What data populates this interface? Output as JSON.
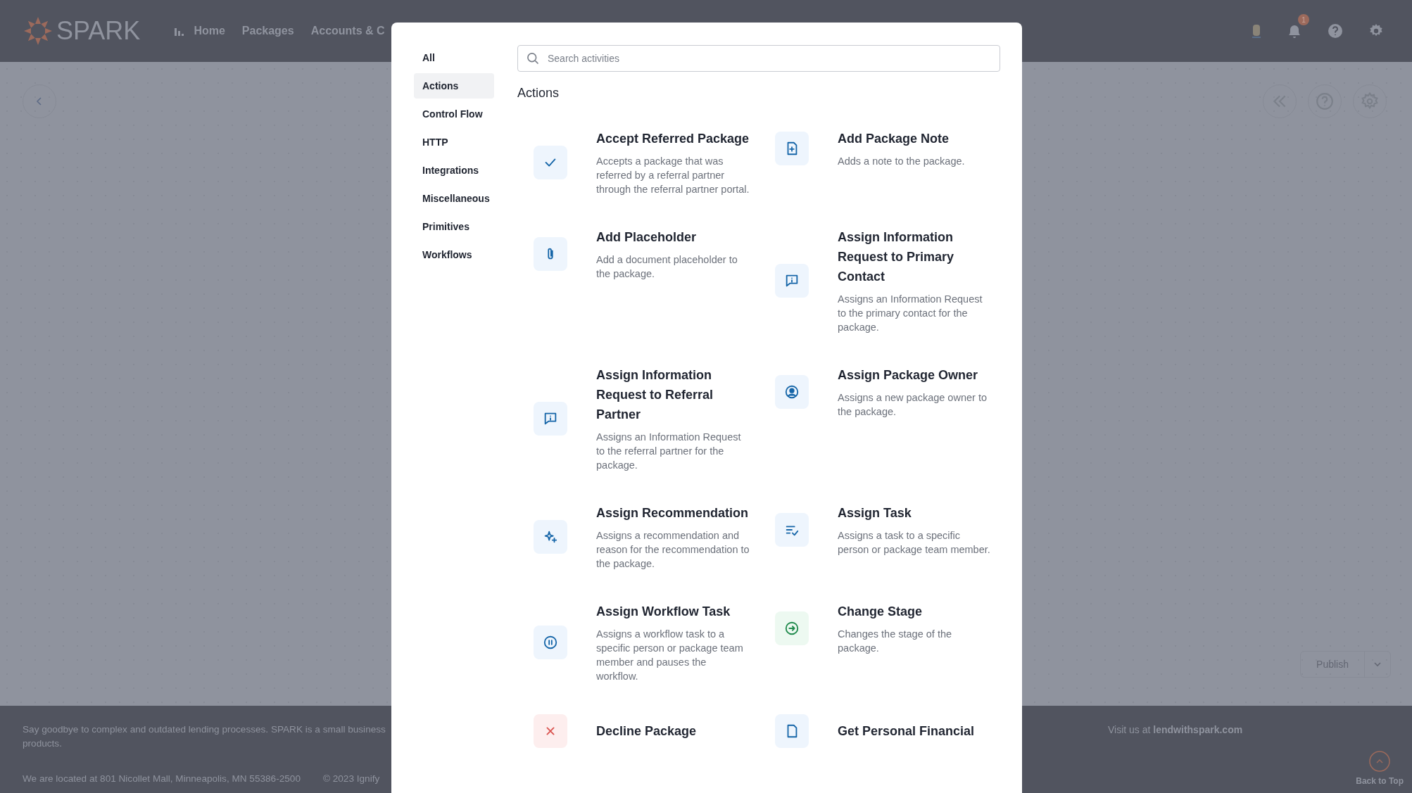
{
  "header": {
    "logo": "SPARK",
    "nav": [
      "Home",
      "Packages",
      "Accounts & C"
    ],
    "notification_count": "1"
  },
  "canvas": {
    "publish_button": "Publish"
  },
  "footer": {
    "tagline": "Say goodbye to complex and outdated lending processes. SPARK is a small business",
    "tagline_continued": "products.",
    "address": "We are located at 801 Nicollet Mall, Minneapolis, MN 55386-2500",
    "copyright": "© 2023 Ignify",
    "visit": "Visit us at **lendwithspark.com**",
    "back_to_top": "Back to Top"
  },
  "modal": {
    "categories": [
      {
        "label": "All",
        "selected": false
      },
      {
        "label": "Actions",
        "selected": true
      },
      {
        "label": "Control Flow",
        "selected": false
      },
      {
        "label": "HTTP",
        "selected": false
      },
      {
        "label": "Integrations",
        "selected": false
      },
      {
        "label": "Miscellaneous",
        "selected": false
      },
      {
        "label": "Primitives",
        "selected": false
      },
      {
        "label": "Workflows",
        "selected": false
      }
    ],
    "search": {
      "placeholder": "Search activities"
    },
    "section_title": "Actions",
    "activities": [
      {
        "title": "Accept Referred Package",
        "description": "Accepts a package that was referred by a referral partner through the referral partner portal.",
        "color": "#1565a8"
      },
      {
        "title": "Add Package Note",
        "description": "Adds a note to the package.",
        "color": "#1565a8"
      },
      {
        "title": "Add Placeholder",
        "description": "Add a document placeholder to the package.",
        "color": "#1565a8"
      },
      {
        "title": "Assign Information Request to Primary Contact",
        "description": "Assigns an Information Request to the primary contact for the package.",
        "color": "#1565a8"
      },
      {
        "title": "Assign Information Request to Referral Partner",
        "description": "Assigns an Information Request to the referral partner for the package.",
        "color": "#1565a8"
      },
      {
        "title": "Assign Package Owner",
        "description": "Assigns a new package owner to the package.",
        "color": "#1565a8"
      },
      {
        "title": "Assign Recommendation",
        "description": "Assigns a recommendation and reason for the recommendation to the package.",
        "color": "#1565a8"
      },
      {
        "title": "Assign Task",
        "description": "Assigns a task to a specific person or package team member.",
        "color": "#1565a8"
      },
      {
        "title": "Assign Workflow Task",
        "description": "Assigns a workflow task to a specific person or package team member and pauses the workflow.",
        "color": "#1565a8"
      },
      {
        "title": "Change Stage",
        "description": "Changes the stage of the package.",
        "color": "#1f8a4c"
      },
      {
        "title": "Decline Package",
        "color": "#d9534f"
      },
      {
        "title": "Get Personal Financial",
        "color": "#1565a8"
      }
    ]
  }
}
